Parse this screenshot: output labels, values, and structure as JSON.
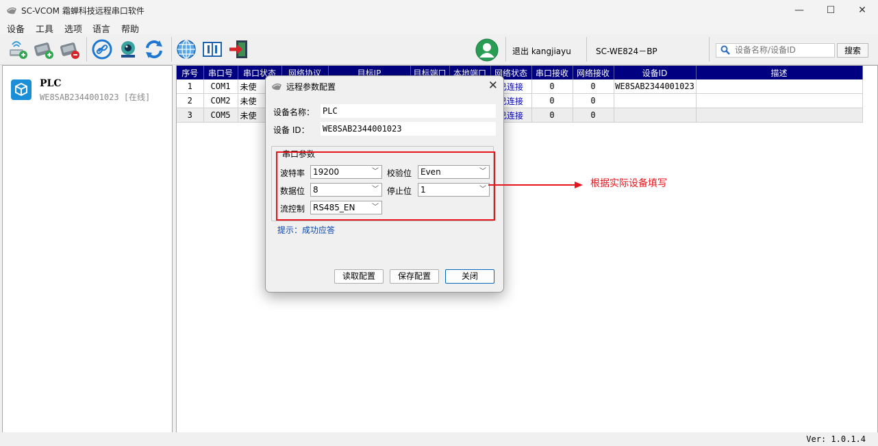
{
  "window": {
    "title": "SC-VCOM 霜蝉科技远程串口软件",
    "controls": {
      "minimize": "—",
      "maximize": "☐",
      "close": "✕"
    }
  },
  "menu": [
    "设备",
    "工具",
    "选项",
    "语言",
    "帮助"
  ],
  "toolbar": {
    "icons": [
      "add-device-icon",
      "add-network-device-icon",
      "remove-device-icon",
      "link-icon",
      "camera-icon",
      "refresh-icon",
      "globe-icon",
      "manual-icon",
      "exit-icon"
    ],
    "logout_label": "退出 kangjiayu",
    "device_model": "SC-WE824－BP",
    "search_placeholder": "设备名称/设备ID",
    "search_button": "搜索"
  },
  "device_list": [
    {
      "name": "PLC",
      "id_status": "WE8SAB2344001023 [在线]"
    }
  ],
  "table": {
    "headers": [
      "序号",
      "串口号",
      "串口状态",
      "网络协议",
      "目标IP",
      "目标端口",
      "本地端口",
      "网络状态",
      "串口接收",
      "网络接收",
      "设备ID",
      "描述"
    ],
    "rows": [
      [
        "1",
        "COM1",
        "未使",
        "",
        "",
        "",
        "",
        "已连接",
        "0",
        "0",
        "WE8SAB2344001023",
        ""
      ],
      [
        "2",
        "COM2",
        "未使",
        "",
        "",
        "",
        "",
        "已连接",
        "0",
        "0",
        "",
        ""
      ],
      [
        "3",
        "COM5",
        "未使",
        "",
        "",
        "",
        "",
        "已连接",
        "0",
        "0",
        "",
        ""
      ]
    ]
  },
  "dialog": {
    "title": "远程参数配置",
    "close": "✕",
    "device_name_label": "设备名称：",
    "device_name": "PLC",
    "device_id_label": "设备 ID：",
    "device_id": "WE8SAB2344001023",
    "group_title": "串口参数",
    "baud_label": "波特率",
    "baud": "19200",
    "parity_label": "校验位",
    "parity": "Even",
    "databits_label": "数据位",
    "databits": "8",
    "stopbits_label": "停止位",
    "stopbits": "1",
    "flow_label": "流控制",
    "flow": "RS485_EN",
    "hint": "提示：成功应答",
    "read_button": "读取配置",
    "save_button": "保存配置",
    "close_button": "关闭"
  },
  "annotation": {
    "text": "根据实际设备填写",
    "color": "#e8141b"
  },
  "status_bar": {
    "version": "Ver: 1.0.1.4"
  },
  "colors": {
    "table_header": "#000080",
    "connected": "#0000c0",
    "hint": "#0645ad"
  }
}
